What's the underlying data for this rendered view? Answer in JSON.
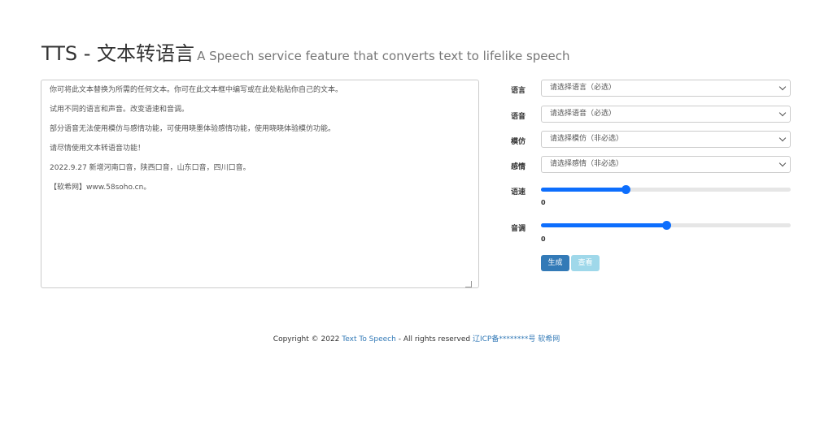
{
  "header": {
    "title": "TTS - 文本转语言",
    "subtitle": "A Speech service feature that converts text to lifelike speech"
  },
  "editor": {
    "text": "你可将此文本替换为所需的任何文本。你可在此文本框中编写或在此处粘贴你自己的文本。\n\n试用不同的语言和声音。改变语速和音调。\n\n部分语音无法使用模仿与感情功能，可使用晓墨体验感情功能，使用晓晓体验模仿功能。\n\n请尽情使用文本转语音功能！\n\n2022.9.27 新增河南口音，陕西口音，山东口音，四川口音。\n\n【软希网】www.58soho.cn。"
  },
  "form": {
    "language": {
      "label": "语言",
      "value": "请选择语言（必选）"
    },
    "voice": {
      "label": "语音",
      "value": "请选择语音（必选）"
    },
    "imitate": {
      "label": "模仿",
      "value": "请选择模仿（非必选）"
    },
    "emotion": {
      "label": "感情",
      "value": "请选择感情（非必选）"
    },
    "rate": {
      "label": "语速",
      "value": "0",
      "level": 0.34
    },
    "pitch": {
      "label": "音调",
      "value": "0",
      "level": 0.5
    }
  },
  "buttons": {
    "generate": "生成",
    "view": "查看"
  },
  "footer": {
    "copyright": "Copyright © 2022",
    "site_link": "Text To Speech",
    "rights": "- All rights reserved",
    "icp_link": "辽ICP备********号 软希网"
  },
  "colors": {
    "primary": "#337ab7",
    "info": "#9fd8ea",
    "slider": "#0d6efd"
  }
}
